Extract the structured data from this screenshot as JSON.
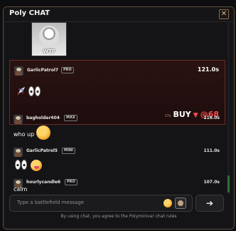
{
  "window": {
    "title": "Poly CHAT",
    "close_glyph": "✕"
  },
  "meme": {
    "caption": "WTF"
  },
  "messages": [
    {
      "user": "GarlicPatrol7",
      "badge": "PRO",
      "time": "121.0s",
      "trade": {
        "side": "BUY",
        "direction": "▼",
        "price": "@68",
        "small": "17s"
      }
    },
    {
      "user": "bagholder404",
      "badge": "MAX",
      "time": "116.0s",
      "text": "who up"
    },
    {
      "user": "GarlicPatrol5",
      "badge": "MINI",
      "time": "111.0s"
    },
    {
      "user": "hourlycandle6",
      "badge": "PRO",
      "time": "107.0s",
      "text": "calm"
    }
  ],
  "composer": {
    "placeholder": "Type a battlefield message",
    "send_glyph": "➔"
  },
  "footer": "By using chat, you agree to the Polyminivar chat rules",
  "colors": {
    "accent_red": "#ff4d4d",
    "highlight_bg": "#2a1212",
    "border": "#5a4a3a"
  }
}
